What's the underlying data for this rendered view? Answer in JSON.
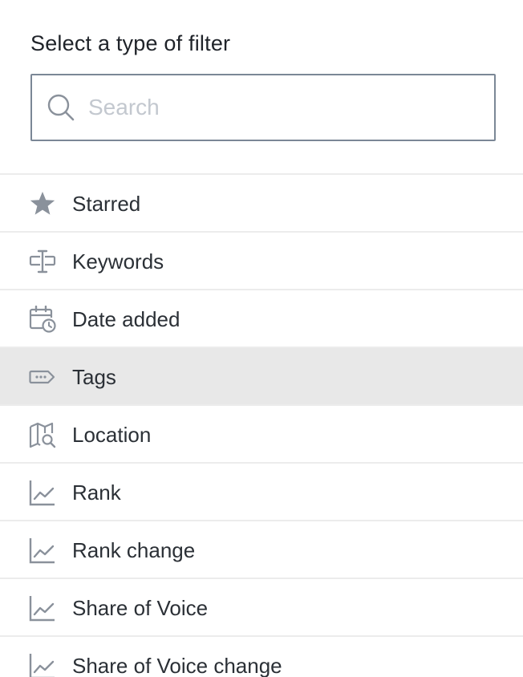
{
  "header": {
    "title": "Select a type of filter"
  },
  "search": {
    "placeholder": "Search",
    "value": ""
  },
  "filter_types": [
    {
      "label": "Starred",
      "icon": "star-icon"
    },
    {
      "label": "Keywords",
      "icon": "keyword-cursor-icon"
    },
    {
      "label": "Date added",
      "icon": "calendar-clock-icon"
    },
    {
      "label": "Tags",
      "icon": "tag-icon",
      "highlighted": true
    },
    {
      "label": "Location",
      "icon": "map-search-icon"
    },
    {
      "label": "Rank",
      "icon": "line-chart-icon"
    },
    {
      "label": "Rank change",
      "icon": "line-chart-icon"
    },
    {
      "label": "Share of Voice",
      "icon": "line-chart-icon"
    },
    {
      "label": "Share of Voice change",
      "icon": "line-chart-icon"
    }
  ],
  "colors": {
    "icon": "#8a919b",
    "text": "#2b3036",
    "highlight_bg": "#e8e8e8",
    "divider": "#ececec",
    "search_border": "#7b8796"
  }
}
